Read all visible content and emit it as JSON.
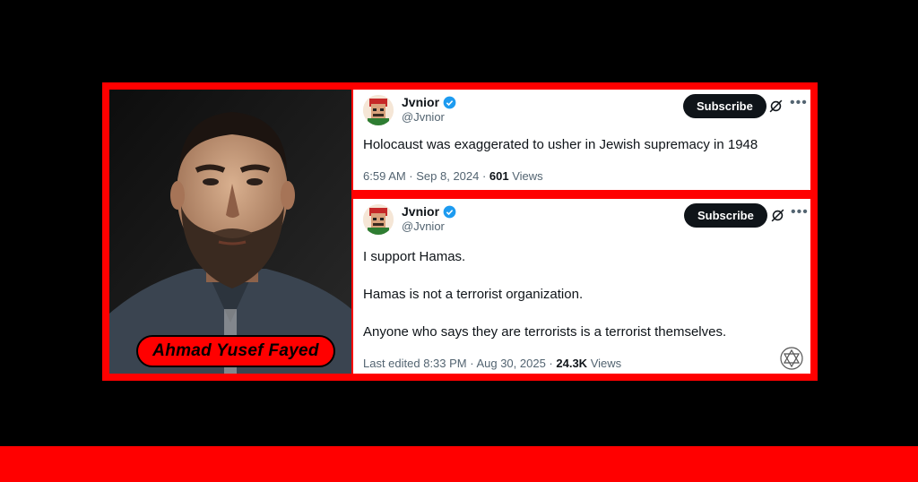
{
  "overlay": {
    "person_name": "Ahmad Yusef Fayed"
  },
  "tweets": [
    {
      "display_name": "Jvnior",
      "handle": "@Jvnior",
      "subscribe_label": "Subscribe",
      "text": [
        "Holocaust was exaggerated to usher in Jewish supremacy in 1948"
      ],
      "meta_prefix": "6:59 AM · Sep 8, 2024 · ",
      "views_count": "601",
      "views_label": " Views"
    },
    {
      "display_name": "Jvnior",
      "handle": "@Jvnior",
      "subscribe_label": "Subscribe",
      "text": [
        "I support Hamas.",
        "Hamas is not a terrorist organization.",
        "Anyone who says they are terrorists is a terrorist themselves."
      ],
      "meta_prefix": "Last edited 8:33 PM · Aug 30, 2025 · ",
      "views_count": "24.3K",
      "views_label": " Views"
    }
  ],
  "icons": {
    "verified": "verified-badge-icon",
    "grok": "grok-icon",
    "more": "more-icon",
    "watermark": "star-of-david-icon"
  },
  "colors": {
    "frame": "#ff0000",
    "verified": "#1d9bf0",
    "subscribe_bg": "#0f1419",
    "muted_text": "#536471"
  }
}
